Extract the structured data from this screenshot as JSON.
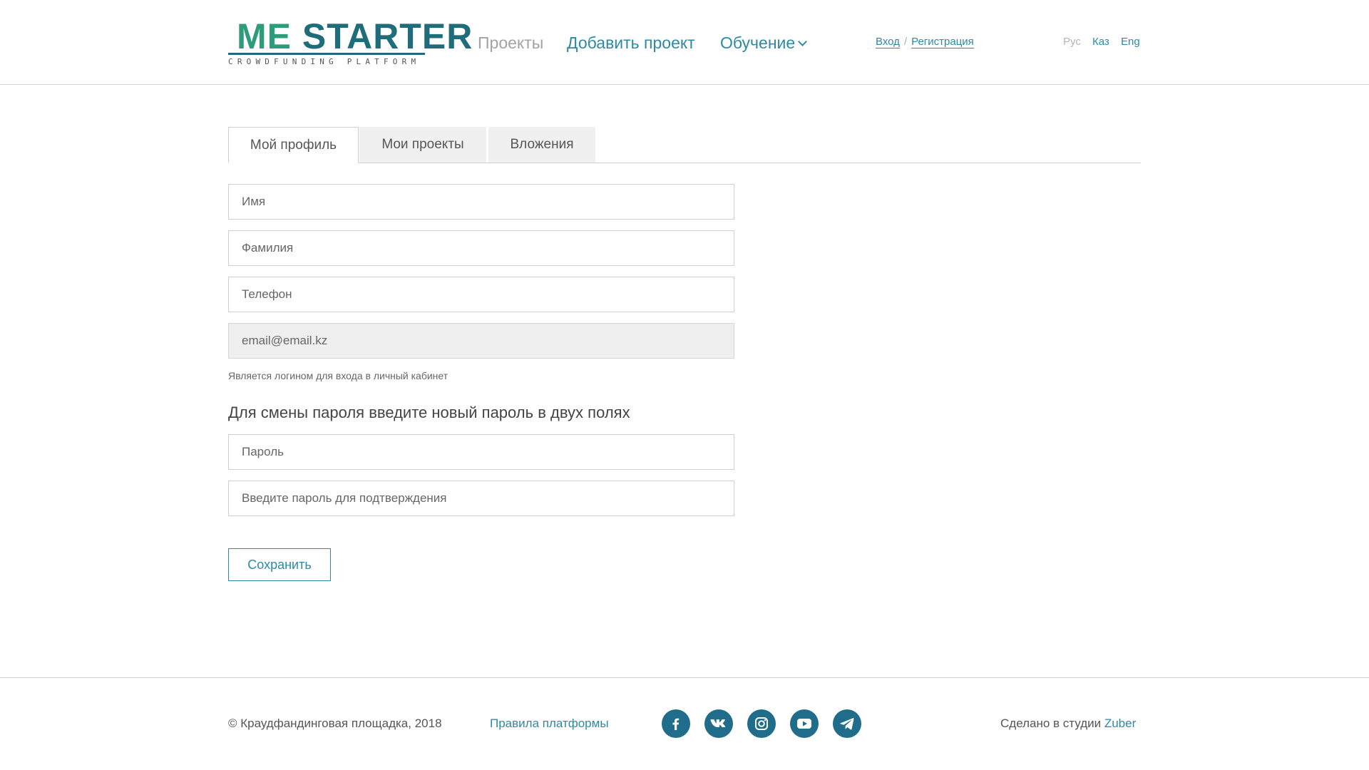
{
  "logo": {
    "text_me": "ME",
    "text_starter": "STARTER",
    "subtitle": "CROWDFUNDING PLATFORM",
    "colors": {
      "green": "#2d9b7c",
      "teal": "#1f6d7a"
    }
  },
  "nav": {
    "projects": "Проекты",
    "add_project": "Добавить проект",
    "learning": "Обучение"
  },
  "auth": {
    "login": "Вход",
    "separator": "/",
    "register": "Регистрация"
  },
  "languages": [
    {
      "label": "Рус",
      "active": false
    },
    {
      "label": "Каз",
      "active": true
    },
    {
      "label": "Eng",
      "active": true
    }
  ],
  "tabs": [
    {
      "label": "Мой профиль",
      "selected": true
    },
    {
      "label": "Мои проекты",
      "selected": false
    },
    {
      "label": "Вложения",
      "selected": false
    }
  ],
  "form": {
    "first_name": {
      "placeholder": "Имя",
      "value": ""
    },
    "last_name": {
      "placeholder": "Фамилия",
      "value": ""
    },
    "phone": {
      "placeholder": "Телефон",
      "value": ""
    },
    "email": {
      "value": "email@email.kz",
      "disabled": true
    },
    "email_hint": "Является логином для входа в личный кабинет",
    "password_heading": "Для смены пароля введите новый пароль в двух полях",
    "password": {
      "placeholder": "Пароль"
    },
    "password_confirm": {
      "placeholder": "Введите пароль для подтверждения"
    },
    "save_label": "Сохранить"
  },
  "footer": {
    "copyright": "© Краудфандинговая площадка, 2018",
    "rules_link": "Правила платформы",
    "social_icons": [
      "facebook-icon",
      "vk-icon",
      "instagram-icon",
      "youtube-icon",
      "telegram-icon"
    ],
    "made_by": "Сделано в студии",
    "studio": "Zuber"
  },
  "colors": {
    "accent": "#2e8aa3",
    "social_bg": "#1f6d8a",
    "disabled_field": "#efefef"
  }
}
